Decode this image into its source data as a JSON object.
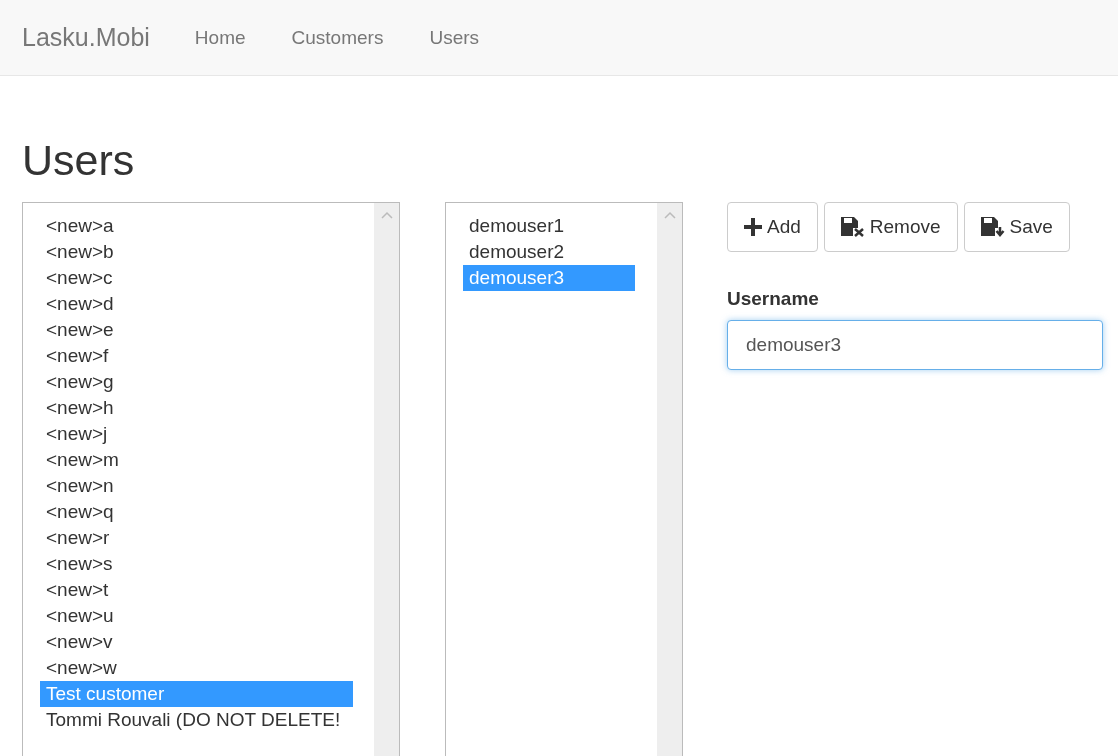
{
  "navbar": {
    "brand": "Lasku.Mobi",
    "links": [
      "Home",
      "Customers",
      "Users"
    ]
  },
  "heading": "Users",
  "customers": [
    {
      "label": "<new>a",
      "selected": false
    },
    {
      "label": "<new>b",
      "selected": false
    },
    {
      "label": "<new>c",
      "selected": false
    },
    {
      "label": "<new>d",
      "selected": false
    },
    {
      "label": "<new>e",
      "selected": false
    },
    {
      "label": "<new>f",
      "selected": false
    },
    {
      "label": "<new>g",
      "selected": false
    },
    {
      "label": "<new>h",
      "selected": false
    },
    {
      "label": "<new>j",
      "selected": false
    },
    {
      "label": "<new>m",
      "selected": false
    },
    {
      "label": "<new>n",
      "selected": false
    },
    {
      "label": "<new>q",
      "selected": false
    },
    {
      "label": "<new>r",
      "selected": false
    },
    {
      "label": "<new>s",
      "selected": false
    },
    {
      "label": "<new>t",
      "selected": false
    },
    {
      "label": "<new>u",
      "selected": false
    },
    {
      "label": "<new>v",
      "selected": false
    },
    {
      "label": "<new>w",
      "selected": false
    },
    {
      "label": "Test customer",
      "selected": true
    },
    {
      "label": "Tommi Rouvali (DO NOT DELETE!",
      "selected": false
    }
  ],
  "users": [
    {
      "label": "demouser1",
      "selected": false
    },
    {
      "label": "demouser2",
      "selected": false
    },
    {
      "label": "demouser3",
      "selected": true
    }
  ],
  "buttons": [
    {
      "kind": "add",
      "label": "Add"
    },
    {
      "kind": "remove",
      "label": "Remove"
    },
    {
      "kind": "save",
      "label": "Save"
    }
  ],
  "form": {
    "label": "Username",
    "value": "demouser3",
    "focused": true
  }
}
